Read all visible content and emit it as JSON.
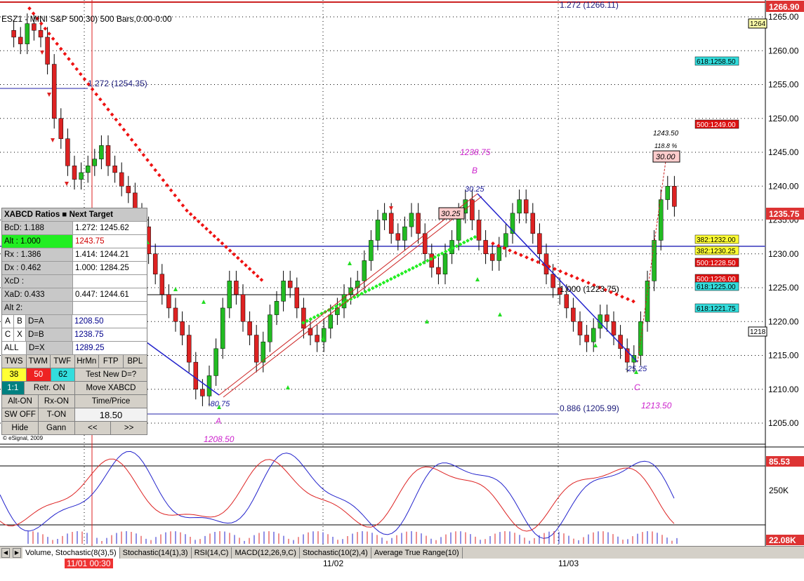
{
  "chart": {
    "title": "ESZ1 - MINI S&P 500,30) 500 Bars,0:00-0:00",
    "copyright": "© eSignal, 2009",
    "price_axis": [
      "1265.00",
      "1260.00",
      "1255.00",
      "1250.00",
      "1245.00",
      "1240.00",
      "1235.00",
      "1230.00",
      "1225.00",
      "1220.00",
      "1215.00",
      "1210.00",
      "1205.00"
    ],
    "last_price": "1235.75",
    "top_price": "1266.90",
    "small_labels": [
      "1264",
      "1218"
    ],
    "lower_axis": [
      "85.53",
      "250K",
      "22.08K"
    ],
    "annotations": {
      "fib_top": "1.272 (1266.11)",
      "fib_left": "1.272 (1254.35)",
      "fib_mid": "1.000 (1223.75)",
      "fib_low": "0.886 (1205.99)",
      "label_b_price": "1238.75",
      "label_b": "B",
      "label_a": "A",
      "label_a_price": "1208.50",
      "label_c": "C",
      "label_c_price": "1213.50",
      "val_a": "-80.75",
      "val_b": "30.25",
      "val_c": "-25.25",
      "box_ab": "30.25",
      "box_cd": "30.00",
      "d_price": "1243.50",
      "d_pct": "118.8 %"
    },
    "right_labels": [
      {
        "text": "618:1258.50",
        "color": "#33dddd"
      },
      {
        "text": "500:1249.00",
        "color": "#dd1111"
      },
      {
        "text": "382:1232.00",
        "color": "#ffff33"
      },
      {
        "text": "382:1230.25",
        "color": "#ffff33"
      },
      {
        "text": "500:1228.50",
        "color": "#dd1111"
      },
      {
        "text": "500:1226.00",
        "color": "#dd1111"
      },
      {
        "text": "618:1225.00",
        "color": "#33dddd"
      },
      {
        "text": "618:1221.75",
        "color": "#33dddd"
      }
    ]
  },
  "panel": {
    "header": "XABCD Ratios ■ Next Target",
    "rows": [
      {
        "label": "BcD:   1.188",
        "value": "1.272: 1245.62",
        "vclass": ""
      },
      {
        "label": "Alt  :   1.000",
        "value": "1243.75",
        "vclass": "red",
        "green": true
      },
      {
        "label": "Rx   :   1.386",
        "value": "1.414: 1244.21",
        "vclass": ""
      },
      {
        "label": "Dx   :   0.462",
        "value": "1.000: 1284.25",
        "vclass": ""
      },
      {
        "label": "XcD :",
        "value": "",
        "vclass": ""
      },
      {
        "label": "XaD:   0.433",
        "value": "0.447: 1244.61",
        "vclass": ""
      },
      {
        "label": "Alt 2:",
        "value": "",
        "vclass": ""
      }
    ],
    "targets": [
      {
        "a": "A",
        "b": "B",
        "c": "D=A",
        "v": "1208.50"
      },
      {
        "a": "C",
        "b": "X",
        "c": "D=B",
        "v": "1238.75"
      },
      {
        "a": "ALL",
        "b": "",
        "c": "D=X",
        "v": "1289.25"
      }
    ],
    "btn_row1": [
      "TWS",
      "TWM",
      "TWF",
      "HrMn",
      "FTP",
      "BPL"
    ],
    "btn_row2": [
      "38",
      "50",
      "62",
      "Test New D=?"
    ],
    "btn_row3": [
      "1:1",
      "Retr. ON",
      "Move XABCD"
    ],
    "btn_row4": [
      "Alt-ON",
      "Rx-ON",
      "Time/Price"
    ],
    "btn_row5": [
      "SW OFF",
      "T-ON",
      "18.50"
    ],
    "btn_row6": [
      "Hide",
      "Gann",
      "<<",
      ">>"
    ]
  },
  "tabs": [
    "Volume, Stochastic(8(3),5)",
    "Stochastic(14(1),3)",
    "RSI(14,C)",
    "MACD(12,26,9,C)",
    "Stochastic(10(2),4)",
    "Average True Range(10)"
  ],
  "dates": {
    "cursor": "11/01 00:30",
    "d1": "11/02",
    "d2": "11/03"
  }
}
